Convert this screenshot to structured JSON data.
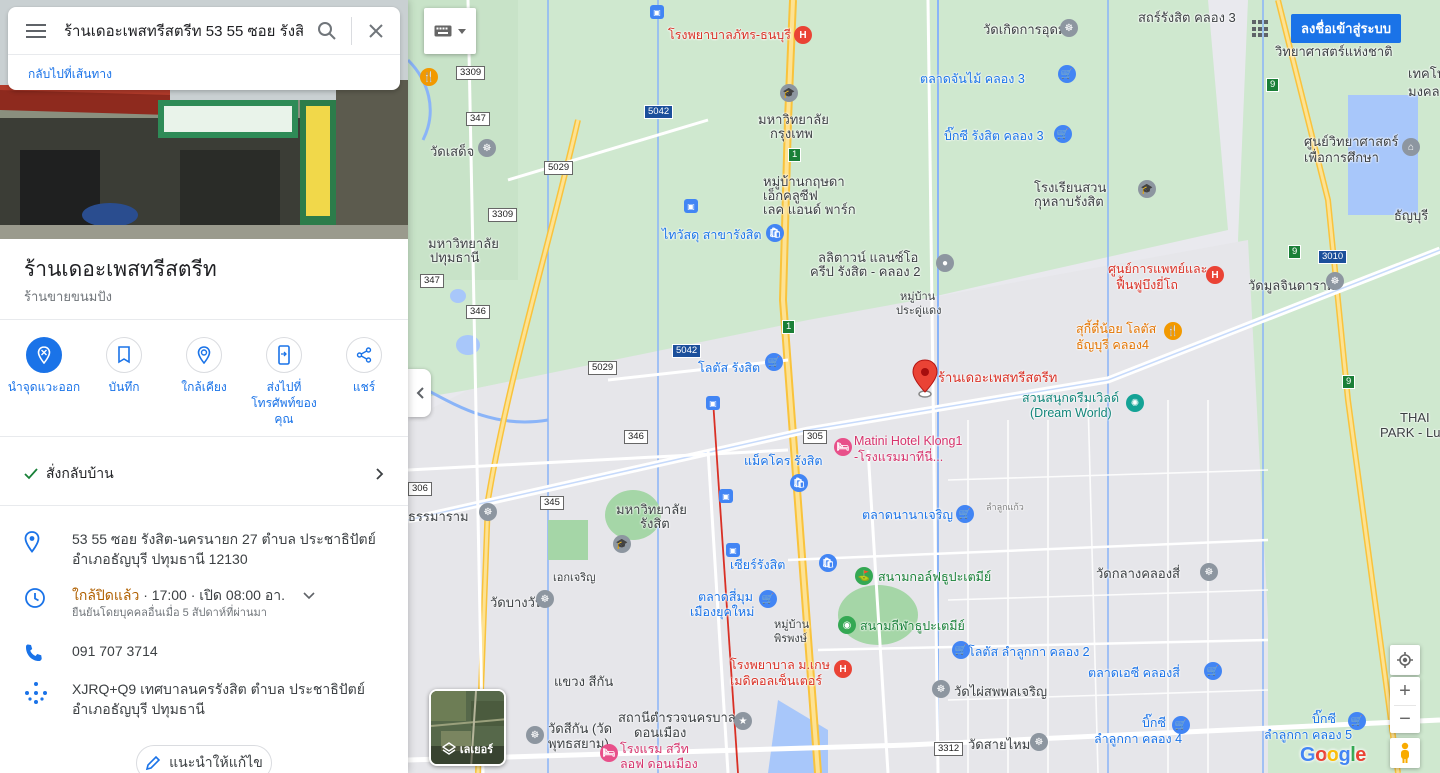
{
  "search": {
    "query": "ร้านเดอะเพสทรีสตรีท 53 55 ซอย รังสิต",
    "back_link": "กลับไปที่เส้นทาง"
  },
  "place": {
    "title": "ร้านเดอะเพสทรีสตรีท",
    "category": "ร้านขายขนมปัง"
  },
  "actions": [
    {
      "label": "นำจุดแวะออก",
      "icon": "remove-stop-icon"
    },
    {
      "label": "บันทึก",
      "icon": "bookmark-icon"
    },
    {
      "label": "ใกล้เคียง",
      "icon": "nearby-icon"
    },
    {
      "label": "ส่งไปที่โทรศัพท์ของคุณ",
      "icon": "send-to-phone-icon"
    },
    {
      "label": "แชร์",
      "icon": "share-icon"
    }
  ],
  "delivery": {
    "label": "สั่งกลับบ้าน"
  },
  "info": {
    "address_line1": "53 55 ซอย รังสิต-นครนายก 27 ตำบล ประชาธิปัตย์",
    "address_line2": "อำเภอธัญบุรี ปทุมธานี 12130",
    "hours_status": "ใกล้ปิดแล้ว",
    "hours_detail": " · 17:00 · เปิด 08:00 อา.",
    "hours_confirmed": "ยืนยันโดยบุคคลอื่นเมื่อ 5 สัปดาห์ที่ผ่านมา",
    "phone": "091 707 3714",
    "plus_code_line1": "XJRQ+Q9 เทศบาลนครรังสิต ตำบล ประชาธิปัตย์",
    "plus_code_line2": "อำเภอธัญบุรี ปทุมธานี"
  },
  "suggest_edit": "แนะนำให้แก้ไข",
  "map": {
    "signin": "ลงชื่อเข้าสู่ระบบ",
    "layers_label": "เลเยอร์",
    "google": "Google",
    "selected_place": "ร้านเดอะเพสทรีสตรีท",
    "labels": {
      "hospital_phyathai": "โรงพยาบาลภัทร-ธนบุรี",
      "wat_koet": "วัดเกิดการอุดม",
      "talat_chanmai": "ตลาดจันไม้ คลอง 3",
      "uni_krungthep_1": "มหาวิทยาลัย",
      "uni_krungthep_2": "กรุงเทพ",
      "bigc_rangsit3": "บิ๊กซี รังสิต คลอง 3",
      "wat_sadet": "วัดเสด็จ",
      "village_green_1": "หมู่บ้านกฤษดา",
      "village_green_2": "เอ็กคลูซีฟ",
      "village_green_3": "เลค แอนด์ พาร์ก",
      "school_kaset_1": "โรงเรียนสวน",
      "school_kaset_2": "กุหลาบรังสิต",
      "thaiwatsadu": "ไทวัสดุ สาขารังสิต",
      "lotus_mall_1": "ลลิตาวน์ แลนซ์โอ",
      "lotus_mall_2": "ครีป รังสิต - คลอง 2",
      "rehab_1": "ศูนย์การแพทย์และ",
      "rehab_2": "ฟื้นฟูบึงยี่โถ",
      "wat_mulchin": "วัดมูลจินดาราม",
      "uni_pathum_1": "มหาวิทยาลัย",
      "uni_pathum_2": "ปทุมธานี",
      "village_pradu_1": "หมู่บ้าน",
      "village_pradu_2": "ประดู่แดง",
      "sukishi_1": "สุกี้ตี๋น้อย โลตัส",
      "sukishi_2": "ธัญบุรี คลอง4",
      "lotus_rangsit": "โลตัส รังสิต",
      "dreamworld_1": "สวนสนุกดรีมเวิลด์",
      "dreamworld_2": "(Dream World)",
      "matini_1": "Matini Hotel Klong1",
      "matini_2": "-โรงแรมมาทีนี่...",
      "makro": "แม็คโคร รังสิต",
      "uni_rangsit_1": "มหาวิทยาลัย",
      "uni_rangsit_2": "รังสิต",
      "talat_nanajaroen": "ตลาดนานาเจริญ",
      "thammaram": "ธรรมาราม",
      "sriram": "เอกเจริญ",
      "future": "เซียร์รังสิต",
      "wat_klang": "วัดกลางคลองสี่",
      "wat_nuan": "วัดบางวัน",
      "talat_siam_1": "ตลาดสี่มุม",
      "talat_siam_2": "เมืองยุคใหม่",
      "golf": "สนามกอล์ฟธูปะเตมีย์",
      "stadium": "สนามกีฬาธูปะเตมีย์",
      "village_pp_1": "หมู่บ้าน",
      "village_pp_2": "พิรพงษ์",
      "lotus_k2": "โลตัส ลำลูกกา คลอง 2",
      "hospital_pm_1": "โรงพยาบาล ม.เกษ",
      "hospital_pm_2": "เมดิคอลเซ็นเตอร์",
      "khwaeng": "แขวง สีกัน",
      "wat_phaiphon": "วัดไผ่สพพลเจริญ",
      "talat_ae": "ตลาดเอซี คลองสี่",
      "station_1": "สถานีตำรวจนครบาล",
      "station_2": "ดอนเมือง",
      "wat_sikan_1": "วัดสีกัน (วัด",
      "wat_sikan_2": "พุทธสยาม)",
      "hotel_1": "โรงแรม สวีท",
      "hotel_2": "ลอฟ ดอนเมือง",
      "bigc_k4_1": "บิ๊กซี",
      "bigc_k4_2": "ลำลูกกา คลอง 4",
      "bigc_k5_1": "บิ๊กซี",
      "bigc_k5_2": "ลำลูกกา คลอง 5",
      "wat_saimai": "วัดสายไหม",
      "thai_park_1": "THAI",
      "thai_park_2": "PARK - Lum",
      "sci_1": "วิทยาศาสตร์แห่งชาติ",
      "sci_2": "ศูนย์วิทยาศาสตร์",
      "sci_3": "เพื่อการศึกษา",
      "rangsit_k3": "สถร์รังสิต คลอง 3",
      "tech_1": "เทคโนโล",
      "tech_2": "มงคล",
      "thanyaburi": "ธัญบุรี",
      "lamsali": "ลำลูกแก้ว"
    },
    "road_numbers": [
      "3309",
      "347",
      "5029",
      "3309",
      "5042",
      "1",
      "347",
      "346",
      "5029",
      "5042",
      "1",
      "346",
      "305",
      "306",
      "345",
      "9",
      "9",
      "3010",
      "9",
      "3312"
    ]
  }
}
